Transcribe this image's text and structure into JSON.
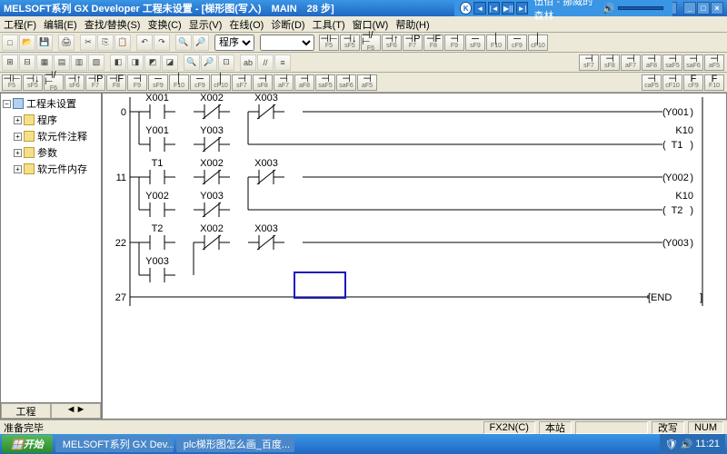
{
  "title": "MELSOFT系列 GX Developer 工程未设置 - [梯形图(写入)　MAIN　28 步]",
  "player": {
    "song": "伍佰 - 挪威的森林",
    "k": "K"
  },
  "menu": [
    "工程(F)",
    "编辑(E)",
    "查找/替换(S)",
    "变换(C)",
    "显示(V)",
    "在线(O)",
    "诊断(D)",
    "工具(T)",
    "窗口(W)",
    "帮助(H)"
  ],
  "dropdown1": "程序",
  "fkeys": [
    [
      "⊣⊢",
      "F5"
    ],
    [
      "⊣↓",
      "sF5"
    ],
    [
      "⊣/⊢",
      "F6"
    ],
    [
      "⊣↑",
      "sF6"
    ],
    [
      "⊣P",
      "F7"
    ],
    [
      "⊣F",
      "F8"
    ],
    [
      "⊣",
      "F9"
    ],
    [
      "─",
      "sF9"
    ],
    [
      "│",
      "F10"
    ],
    [
      "─",
      "cF9"
    ],
    [
      "│",
      "cF10"
    ],
    [
      "⊣",
      "sF7"
    ],
    [
      "⊣",
      "sF8"
    ],
    [
      "⊣",
      "aF7"
    ],
    [
      "⊣",
      "aF8"
    ],
    [
      "⊣",
      "saF5"
    ],
    [
      "⊣",
      "saF6"
    ],
    [
      "⊣",
      "aF5"
    ],
    [
      "⊣",
      "caF5"
    ],
    [
      "⊣",
      "cF10"
    ],
    [
      "F",
      "cF9"
    ],
    [
      "F",
      "F10"
    ]
  ],
  "tree": {
    "root": "工程未设置",
    "items": [
      "程序",
      "软元件注释",
      "参数",
      "软元件内存"
    ]
  },
  "sidetab": "工程",
  "ladder": {
    "rungs": [
      {
        "step": "0",
        "contacts": [
          {
            "t": "NO",
            "d": "X001"
          },
          {
            "t": "NC",
            "d": "X002"
          },
          {
            "t": "NC",
            "d": "X003"
          }
        ],
        "branch": [
          {
            "t": "NO",
            "d": "Y001"
          },
          {
            "t": "NC",
            "d": "Y003"
          }
        ],
        "coil": "Y001",
        "coil2": {
          "d": "T1",
          "p": "K10"
        }
      },
      {
        "step": "11",
        "contacts": [
          {
            "t": "NO",
            "d": "T1"
          },
          {
            "t": "NC",
            "d": "X002"
          },
          {
            "t": "NC",
            "d": "X003"
          }
        ],
        "branch": [
          {
            "t": "NO",
            "d": "Y002"
          },
          {
            "t": "NC",
            "d": "Y003"
          }
        ],
        "coil": "Y002",
        "coil2": {
          "d": "T2",
          "p": "K10"
        }
      },
      {
        "step": "22",
        "contacts": [
          {
            "t": "NO",
            "d": "T2"
          },
          {
            "t": "NC",
            "d": "X002"
          },
          {
            "t": "NC",
            "d": "X003"
          }
        ],
        "branch": [
          {
            "t": "NO",
            "d": "Y003"
          }
        ],
        "coil": "Y003"
      },
      {
        "step": "27",
        "end": "END"
      }
    ],
    "cursor": {
      "col": 3,
      "row": 4
    }
  },
  "status": {
    "ready": "准备完毕",
    "cpu": "FX2N(C)",
    "host": "本站",
    "mode": "改写",
    "num": "NUM"
  },
  "taskbar": {
    "start": "开始",
    "tasks": [
      "MELSOFT系列 GX Dev...",
      "plc梯形图怎么画_百度..."
    ],
    "time": "11:21"
  }
}
